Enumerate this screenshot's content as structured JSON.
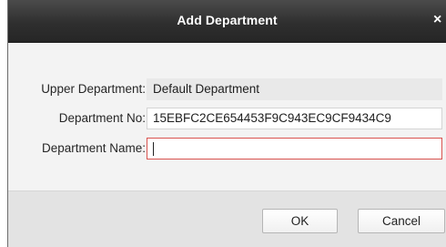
{
  "dialog": {
    "title": "Add Department",
    "close_glyph": "×"
  },
  "form": {
    "upper_department": {
      "label": "Upper Department:",
      "value": "Default Department"
    },
    "department_no": {
      "label": "Department No:",
      "value": "15EBFC2CE654453F9C943EC9CF9434C9"
    },
    "department_name": {
      "label": "Department Name:",
      "value": ""
    }
  },
  "buttons": {
    "ok_label": "OK",
    "cancel_label": "Cancel"
  },
  "colors": {
    "titlebar": "#2f2f2f",
    "error_border": "#d9534f"
  }
}
